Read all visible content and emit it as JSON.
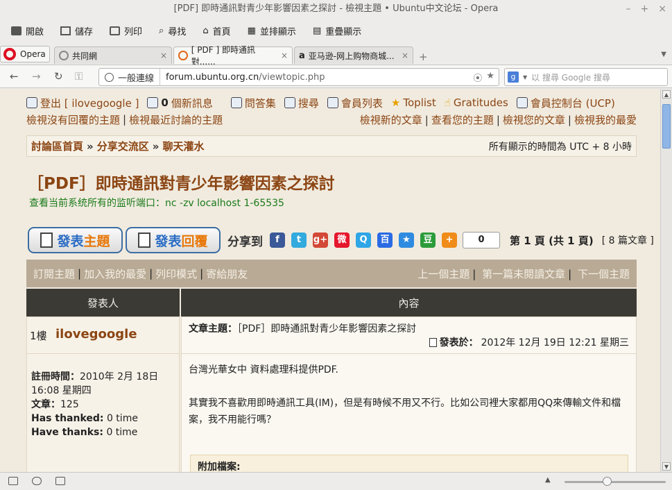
{
  "window": {
    "title": "[PDF] 即時通訊對青少年影響因素之探討 - 檢視主題 • Ubuntu中文论坛 - Opera"
  },
  "toolbar": {
    "items": [
      "開啟",
      "儲存",
      "列印",
      "尋找",
      "首頁",
      "並排顯示",
      "重疊顯示"
    ]
  },
  "tabs": {
    "opera_label": "Opera",
    "items": [
      {
        "label": "共同網"
      },
      {
        "label": "[ PDF ] 即時通訊對......"
      },
      {
        "label": "亚马逊-网上购物商城..."
      }
    ]
  },
  "addressbar": {
    "security": "一般連線",
    "url_domain": "forum.ubuntu.org.cn",
    "url_path": "/viewtopic.php",
    "search_placeholder": "以 搜尋 Google 搜尋"
  },
  "forum": {
    "topnav": {
      "logout": "登出 [ ilovegoogle ]",
      "pm_count": "0",
      "pm_label": "個新訊息",
      "faq": "問答集",
      "search": "搜尋",
      "members": "會員列表",
      "toplist": "Toplist",
      "gratitudes": "Gratitudes",
      "ucp": "會員控制台 (UCP)",
      "unanswered": "檢視沒有回覆的主題",
      "active": "檢視最近討論的主題",
      "new_posts": "檢視新的文章",
      "your_topics": "查看您的主題",
      "your_posts": "檢視您的文章",
      "favorites": "檢視我的最愛"
    },
    "breadcrumb": {
      "home": "討論區首頁",
      "section": "分享交流区",
      "subsection": "聊天灌水",
      "timezone": "所有顯示的時間為 UTC + 8 小時"
    },
    "topic_title": "［PDF］即時通訊對青少年影響因素之探討",
    "notice": "查看当前系统所有的监听端口：nc -zv localhost 1-65535",
    "actions": {
      "new_topic_a": "發表",
      "new_topic_b": "主題",
      "reply_a": "發表",
      "reply_b": "回覆",
      "share_to": "分享到",
      "share_count": "0",
      "page_info": "第 1 頁 (共 1 頁)",
      "post_count": "[ 8 篇文章 ]"
    },
    "social_icons": [
      {
        "name": "facebook",
        "glyph": "f",
        "color": "#3b5998"
      },
      {
        "name": "twitter",
        "glyph": "t",
        "color": "#33aadd"
      },
      {
        "name": "google-plus",
        "glyph": "g+",
        "color": "#d34836"
      },
      {
        "name": "weibo",
        "glyph": "微",
        "color": "#e6162d"
      },
      {
        "name": "qzone",
        "glyph": "Q",
        "color": "#2fa6e6"
      },
      {
        "name": "baidu",
        "glyph": "百",
        "color": "#2a6be3"
      },
      {
        "name": "favorite-star",
        "glyph": "★",
        "color": "#2f8be0"
      },
      {
        "name": "douban",
        "glyph": "豆",
        "color": "#2b9c3a"
      },
      {
        "name": "more",
        "glyph": "+",
        "color": "#f08c1a"
      }
    ],
    "options": {
      "subscribe": "訂閱主題",
      "bookmark": "加入我的最愛",
      "print": "列印模式",
      "email": "寄給朋友",
      "prev": "上一個主題",
      "first_unread": "第一篇未閱讀文章",
      "next": "下一個主題"
    },
    "table": {
      "col_author": "發表人",
      "col_content": "內容"
    },
    "post": {
      "floor": "1樓",
      "author": "ilovegoogle",
      "subject_label": "文章主題：",
      "subject": "［PDF］即時通訊對青少年影響因素之探討",
      "posted_label": "發表於：",
      "posted_time": "2012年 12月 19日  12:21 星期三",
      "reg_label": "註冊時間：",
      "reg_time": "2010年 2月 18日 16:08 星期四",
      "posts_label": "文章：",
      "posts_value": "125",
      "has_thanked_label": "Has thanked:",
      "has_thanked_value": "0 time",
      "have_thanks_label": "Have thanks:",
      "have_thanks_value": "0 time",
      "body_1": "台灣光華女中 資料處理科提供PDF.",
      "body_2": "其實我不喜歡用即時通訊工具(IM)，但是有時候不用又不行。比如公司裡大家都用QQ來傳輸文件和檔案，我不用能行嗎？",
      "attach_label": "附加檔案:"
    }
  }
}
